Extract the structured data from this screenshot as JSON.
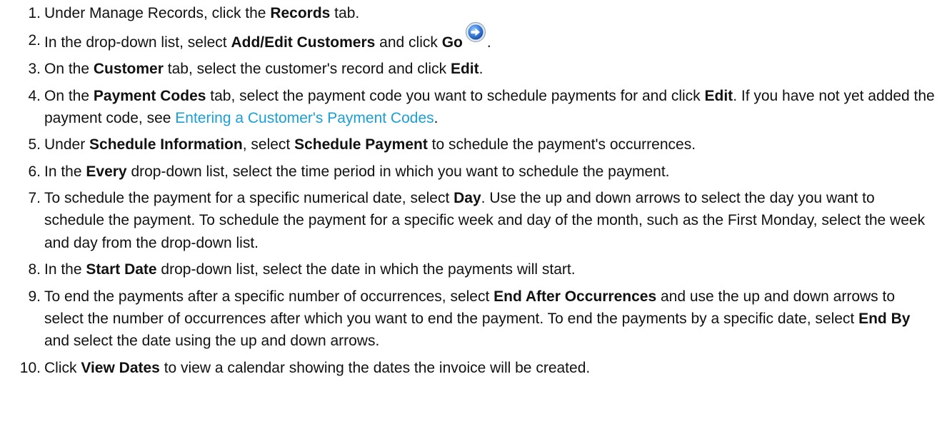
{
  "steps": [
    {
      "number": "1.",
      "parts": [
        "Under Manage Records, click the ",
        "Records",
        " tab."
      ]
    },
    {
      "number": "2.",
      "parts": [
        "In the drop-down list, select ",
        "Add/Edit Customers",
        " and click ",
        "Go",
        "."
      ],
      "icon": "go-arrow-icon"
    },
    {
      "number": "3.",
      "parts": [
        "On the ",
        "Customer",
        " tab, select the customer's record and click ",
        "Edit",
        "."
      ]
    },
    {
      "number": "4.",
      "parts": [
        "On the ",
        "Payment Codes",
        " tab, select the payment code you want to schedule payments for and click ",
        "Edit",
        ". If you have not yet added the payment code, see ",
        "Entering a Customer's Payment Codes",
        "."
      ]
    },
    {
      "number": "5.",
      "parts": [
        "Under ",
        "Schedule Information",
        ", select ",
        "Schedule Payment",
        " to schedule the payment's occurrences."
      ]
    },
    {
      "number": "6.",
      "parts": [
        "In the ",
        "Every",
        " drop-down list, select the time period in which you want to schedule the payment."
      ]
    },
    {
      "number": "7.",
      "parts": [
        "To schedule the payment for a specific numerical date, select ",
        "Day",
        ". Use the up and down arrows to select the day you want to schedule the payment. To schedule the payment for a specific week and day of the month, such as the First Monday, select the week and day from the drop-down list."
      ]
    },
    {
      "number": "8.",
      "parts": [
        "In the ",
        "Start Date",
        " drop-down list, select the date in which the payments will start."
      ]
    },
    {
      "number": "9.",
      "parts": [
        "To end the payments after a specific number of occurrences, select ",
        "End After Occurrences",
        " and use the up and down arrows to select the number of occurrences after which you want to end the payment. To end the payments by a specific date, select ",
        "End By",
        " and select the date using the up and down arrows."
      ]
    },
    {
      "number": "10.",
      "parts": [
        "Click ",
        "View Dates",
        " to view a calendar showing the dates the invoice will be created."
      ]
    }
  ],
  "colors": {
    "text": "#111111",
    "link": "#1a9fd6",
    "icon_blue": "#2f6fd0"
  }
}
